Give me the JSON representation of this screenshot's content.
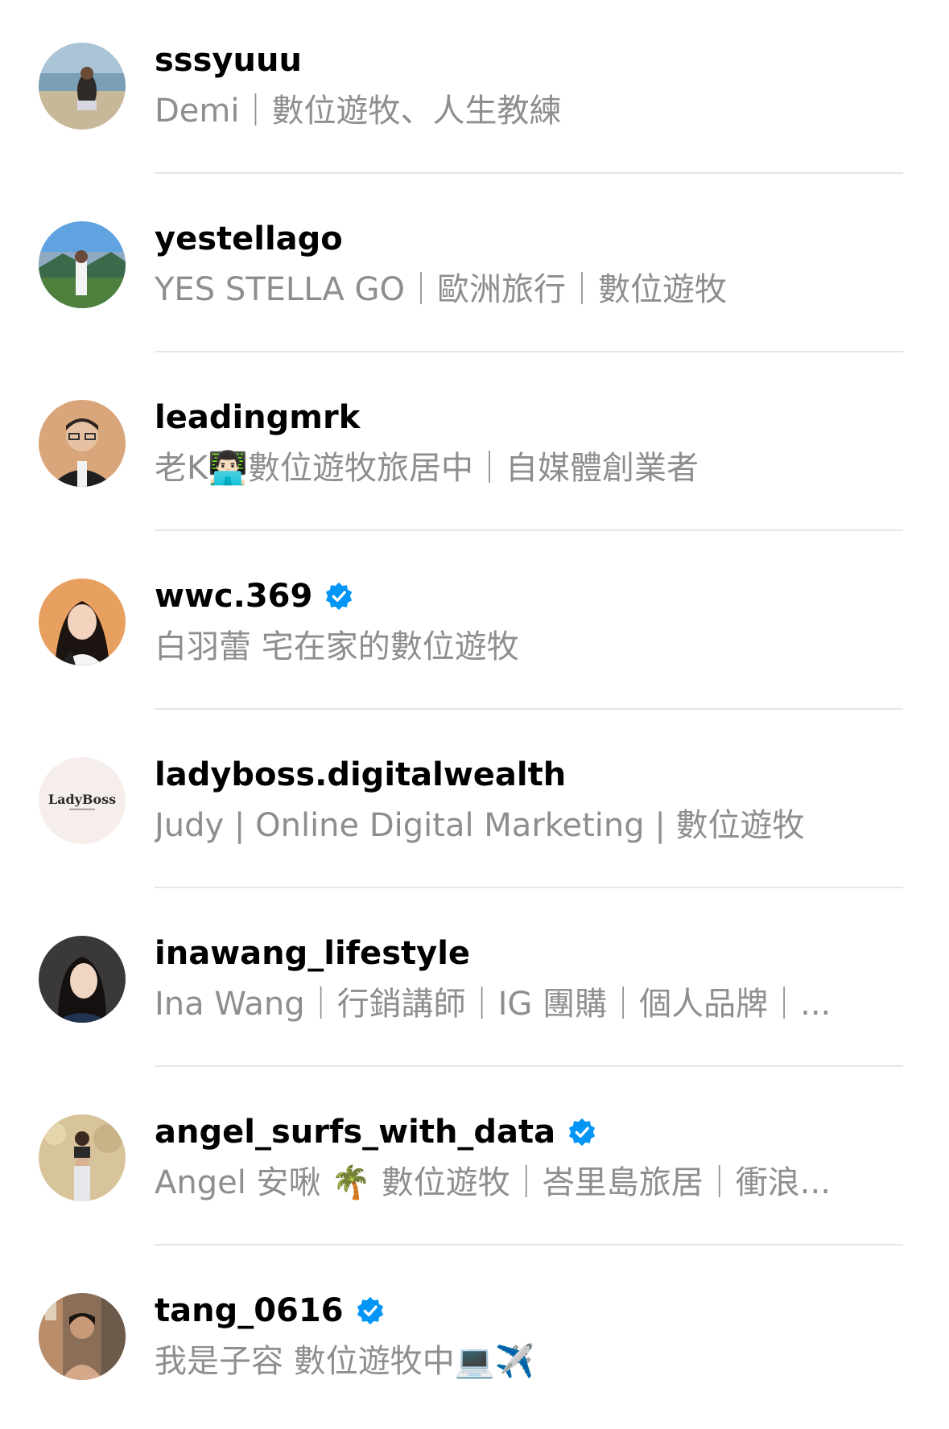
{
  "accounts": [
    {
      "username": "sssyuuu",
      "subtitle": "Demi｜數位遊牧、人生教練",
      "verified": false,
      "avatar": "beach-person-avatar"
    },
    {
      "username": "yestellago",
      "subtitle": "YES STELLA GO｜歐洲旅行｜數位遊牧",
      "verified": false,
      "avatar": "mountain-lake-person-avatar"
    },
    {
      "username": "leadingmrk",
      "subtitle": "老K👨🏻‍💻數位遊牧旅居中｜自媒體創業者",
      "verified": false,
      "avatar": "man-with-glasses-avatar"
    },
    {
      "username": "wwc.369",
      "subtitle": "白羽蕾 宅在家的數位遊牧",
      "verified": true,
      "avatar": "woman-portrait-avatar"
    },
    {
      "username": "ladyboss.digitalwealth",
      "subtitle": "Judy | Online Digital Marketing | 數位遊牧",
      "verified": false,
      "avatar": "ladyboss-logo-avatar",
      "avatar_logo_text": "LadyBoss"
    },
    {
      "username": "inawang_lifestyle",
      "subtitle": "Ina Wang｜行銷講師｜IG 團購｜個人品牌｜...",
      "verified": false,
      "avatar": "woman-dark-portrait-avatar"
    },
    {
      "username": "angel_surfs_with_data",
      "subtitle": "Angel 安啾 🌴 數位遊牧｜峇里島旅居｜衝浪...",
      "verified": true,
      "avatar": "woman-standing-avatar"
    },
    {
      "username": "tang_0616",
      "subtitle": "我是子容 數位遊牧中💻✈️",
      "verified": true,
      "avatar": "woman-street-avatar"
    }
  ],
  "colors": {
    "username": "#000000",
    "subtitle": "#8e8e8e",
    "divider": "#e6e6e6",
    "verified_badge": "#0095f6"
  }
}
